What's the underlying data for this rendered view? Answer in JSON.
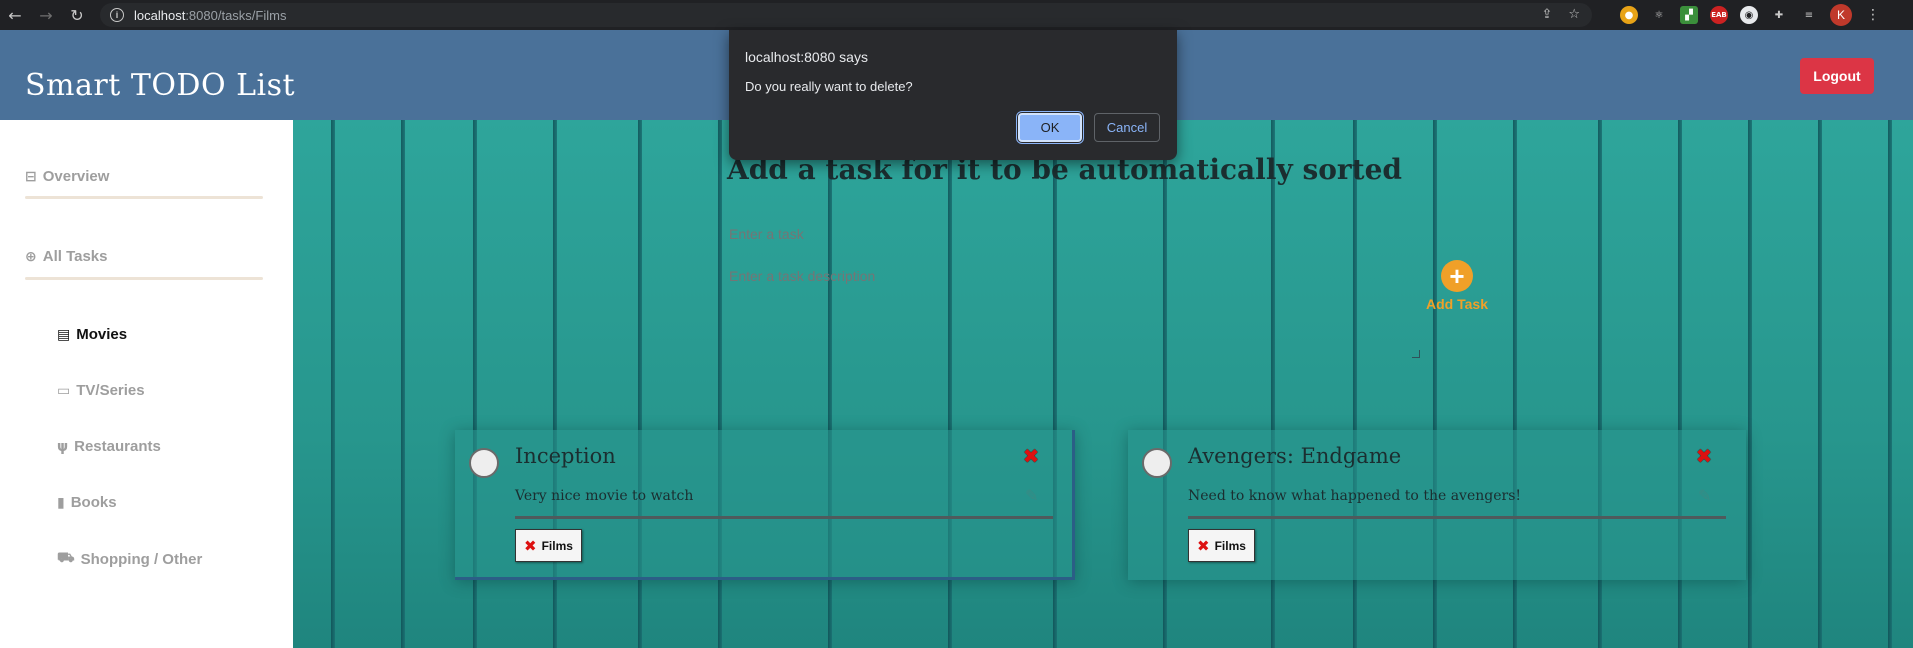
{
  "browser": {
    "url_host": "localhost",
    "url_path": ":8080/tasks/Films",
    "avatar_letter": "K",
    "extension_labels": [
      "EAB"
    ]
  },
  "header": {
    "brand": "Smart TODO List",
    "logout_label": "Logout"
  },
  "sidebar": {
    "overview": "Overview",
    "all_tasks": "All Tasks",
    "categories": [
      {
        "label": "Movies",
        "icon": "film-icon",
        "active": true
      },
      {
        "label": "TV/Series",
        "icon": "tv-icon",
        "active": false
      },
      {
        "label": "Restaurants",
        "icon": "utensils-icon",
        "active": false
      },
      {
        "label": "Books",
        "icon": "book-icon",
        "active": false
      },
      {
        "label": "Shopping / Other",
        "icon": "cart-icon",
        "active": false
      }
    ]
  },
  "main": {
    "title": "Add a task for it to be automatically sorted",
    "task_placeholder": "Enter a task",
    "description_placeholder": "Enter a task description",
    "add_task_label": "Add Task"
  },
  "tasks": [
    {
      "title": "Inception",
      "description": "Very nice movie to watch",
      "tag": "Films"
    },
    {
      "title": "Avengers: Endgame",
      "description": "Need to know what happened to the avengers!",
      "tag": "Films"
    }
  ],
  "dialog": {
    "title": "localhost:8080 says",
    "message": "Do you really want to delete?",
    "ok_label": "OK",
    "cancel_label": "Cancel"
  },
  "colors": {
    "header_bg": "#4a7199",
    "logout_bg": "#dc3545",
    "accent_add": "#f0a028",
    "teal_bg": "#2a9d95"
  }
}
